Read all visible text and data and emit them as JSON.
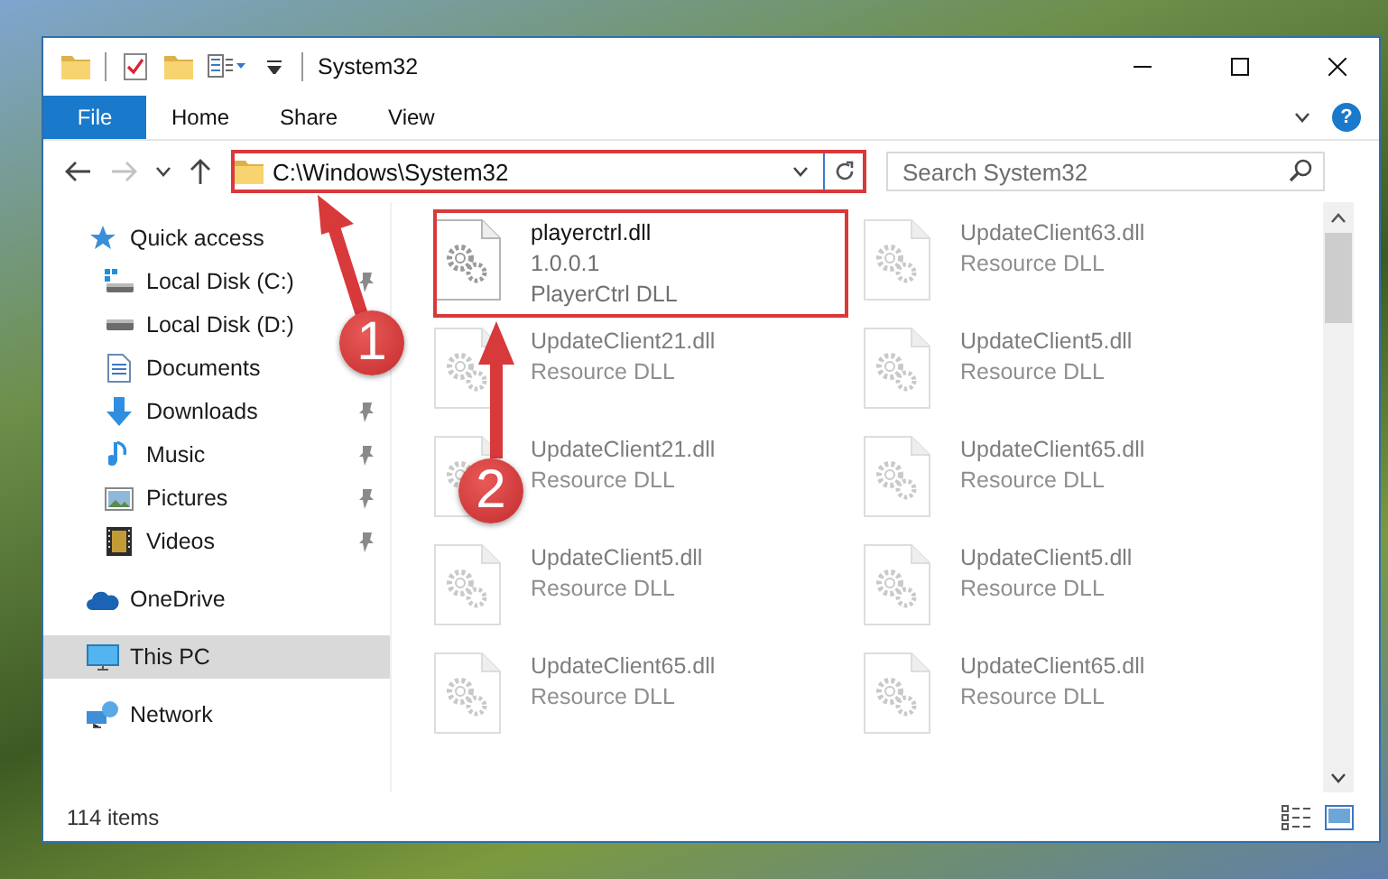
{
  "window": {
    "title": "System32"
  },
  "ribbon": {
    "file_button": "File",
    "tabs": [
      {
        "label": "Home"
      },
      {
        "label": "Share"
      },
      {
        "label": "View"
      }
    ],
    "help_button": "?"
  },
  "address_bar": {
    "path": "C:\\Windows\\System32"
  },
  "search": {
    "placeholder": "Search System32"
  },
  "navigation": {
    "items": [
      {
        "label": "Quick access",
        "kind": "quick-access",
        "selected": false,
        "children": [
          {
            "label": "Local Disk (C:)",
            "kind": "system-drive",
            "pinned": true,
            "selected": false
          },
          {
            "label": "Local Disk (D:)",
            "kind": "drive",
            "pinned": false,
            "selected": false
          },
          {
            "label": "Documents",
            "kind": "documents",
            "pinned": false,
            "selected": false
          },
          {
            "label": "Downloads",
            "kind": "downloads",
            "pinned": true,
            "selected": false
          },
          {
            "label": "Music",
            "kind": "music",
            "pinned": true,
            "selected": false
          },
          {
            "label": "Pictures",
            "kind": "pictures",
            "pinned": true,
            "selected": false
          },
          {
            "label": "Videos",
            "kind": "videos",
            "pinned": true,
            "selected": false
          }
        ]
      },
      {
        "label": "OneDrive",
        "kind": "cloud",
        "selected": false
      },
      {
        "label": "This PC",
        "kind": "computer",
        "selected": true
      },
      {
        "label": "Network",
        "kind": "network",
        "selected": false
      }
    ]
  },
  "files": [
    {
      "name": "playerctrl.dll",
      "version": "1.0.0.1",
      "description": "PlayerCtrl DLL",
      "blurred": false
    },
    {
      "name": "UpdateClient63.dll",
      "description": "Resource DLL",
      "blurred": true
    },
    {
      "name": "UpdateClient21.dll",
      "description": "Resource DLL",
      "blurred": true
    },
    {
      "name": "UpdateClient5.dll",
      "description": "Resource DLL",
      "blurred": true
    },
    {
      "name": "UpdateClient21.dll",
      "description": "Resource DLL",
      "blurred": true
    },
    {
      "name": "UpdateClient65.dll",
      "description": "Resource DLL",
      "blurred": true
    },
    {
      "name": "UpdateClient5.dll",
      "description": "Resource DLL",
      "blurred": true
    },
    {
      "name": "UpdateClient5.dll",
      "description": "Resource DLL",
      "blurred": true
    },
    {
      "name": "UpdateClient65.dll",
      "description": "Resource DLL",
      "blurred": true
    },
    {
      "name": "UpdateClient65.dll",
      "description": "Resource DLL",
      "blurred": true
    }
  ],
  "status_bar": {
    "item_count": "114 items"
  },
  "markers": [
    {
      "label": "1"
    },
    {
      "label": "2"
    }
  ]
}
